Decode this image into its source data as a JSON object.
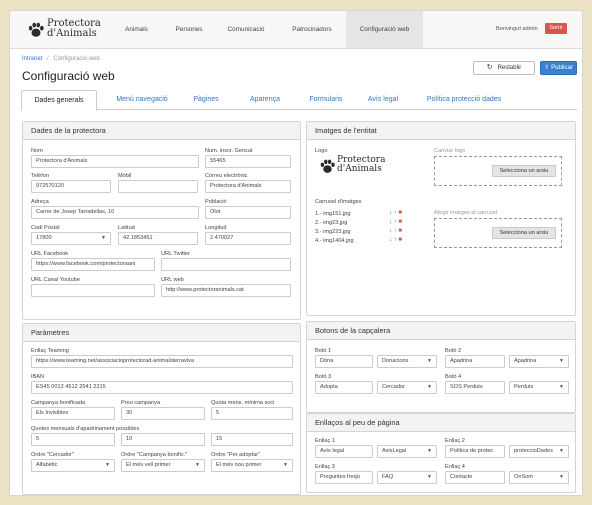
{
  "nav": {
    "logo_line1": "Protectora",
    "logo_line2": "d'Animals",
    "items": [
      "Animals",
      "Persones",
      "Comunicació",
      "Patrocinadors",
      "Configuració web"
    ],
    "welcome": "Benvingut admin",
    "exit": "Sortir"
  },
  "breadcrumb": {
    "root": "Intranet",
    "sep": "/",
    "current": "Configuració web"
  },
  "page_title": "Configuració web",
  "actions": {
    "restore": "Restablir",
    "publish": "Publicar"
  },
  "tabs": [
    "Dades generals",
    "Menú navegació",
    "Pàgines",
    "Aparença",
    "Formularis",
    "Avís legal",
    "Política protecció dades"
  ],
  "dades": {
    "title": "Dades de la protectora",
    "nom_label": "Nom",
    "nom": "Protectora d'Animals",
    "insc_label": "Num. inscr. Gencat",
    "insc": "55465",
    "tel_label": "Telèfon",
    "tel": "972570120",
    "mobil_label": "Mòbil",
    "mobil": "",
    "email_label": "Correu electrònic",
    "email": "Protectora d'Animals",
    "adreca_label": "Adreça",
    "adreca": "Carrer de Josep Tarradellas, 10",
    "poblacio_label": "Població",
    "poblacio": "Olot",
    "cp_label": "Codi Postal",
    "cp": "17800",
    "lat_label": "Latitud",
    "lat": "42.1853451",
    "lon_label": "Longitud",
    "lon": "2.470027",
    "fb_label": "URL Facebook",
    "fb": "https://www.facebook.com/protectoraani",
    "tw_label": "URL Twitter",
    "tw": "",
    "yt_label": "URL Canal Youtube",
    "yt": "",
    "web_label": "URL web",
    "web": "http://www.protectoranimals.cat"
  },
  "imatges": {
    "title": "Imatges de l'entitat",
    "logo_label": "Logo",
    "logo_line1": "Protectora",
    "logo_line2": "d'Animals",
    "change_logo": "Canviar logo",
    "select_file": "Selecciona un arxiu",
    "carousel_label": "Carrusel d'imatges",
    "add_images": "Afegir imatges al carrusel",
    "carousel_items": [
      "1.- img151.jpg",
      "2.- img23.jpg",
      "3.- img223.jpg",
      "4.- img1404.jpg"
    ]
  },
  "parametres": {
    "title": "Paràmetres",
    "teaming_label": "Enllaç Teaming",
    "teaming": "https://www.teaming.net/associacioprotectorad-animalsterraviva",
    "iban_label": "IBAN",
    "iban": "ES45 0012 4512 2541 2315",
    "camp_label": "Campanya bonificada",
    "camp": "Els Invisibles",
    "preu_label": "Preu campanya",
    "preu": "30",
    "quota_label": "Quota mens. mínima soci",
    "quota": "5",
    "quotes_label": "Quotes mensuals d'apadrinament possibles",
    "quotes": [
      "5",
      "10",
      "15"
    ],
    "ordre1_label": "Ordre \"Cercador\"",
    "ordre1": "Alfabètic",
    "ordre2_label": "Ordre \"Campanya bonific.\"",
    "ordre2": "El més vell primer",
    "ordre3_label": "Ordre \"Per adoptar\"",
    "ordre3": "El més nou primer"
  },
  "botons": {
    "title": "Botons de la capçalera",
    "b1_label": "Botó 1",
    "b1_text": "Dóna",
    "b1_sel": "Donacions",
    "b2_label": "Botó 2",
    "b2_text": "Apadrina",
    "b2_sel": "Apadrina",
    "b3_label": "Botó 3",
    "b3_text": "Adopta",
    "b3_sel": "Cercador",
    "b4_label": "Botó 4",
    "b4_text": "SOS Perduts",
    "b4_sel": "Perduts"
  },
  "enllacos": {
    "title": "Enllaços al peu de pàgina",
    "e1_label": "Enllaç 1",
    "e1_text": "Avís legal",
    "e1_sel": "AvisLegal",
    "e2_label": "Enllaç 2",
    "e2_text": "Política de protec",
    "e2_sel": "proteccioDades",
    "e3_label": "Enllaç 3",
    "e3_text": "Preguntes freqü",
    "e3_sel": "FAQ",
    "e4_label": "Enllaç 4",
    "e4_text": "Contacte",
    "e4_sel": "OnSom"
  }
}
